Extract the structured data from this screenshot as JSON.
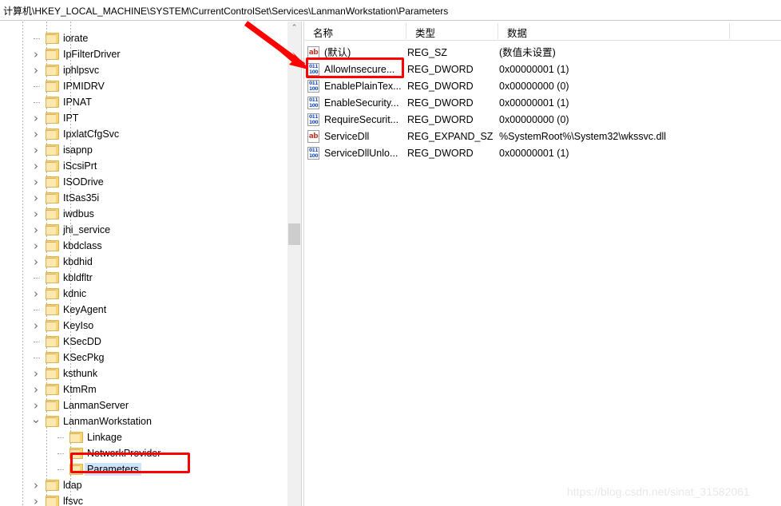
{
  "address": {
    "path": "计算机\\HKEY_LOCAL_MACHINE\\SYSTEM\\CurrentControlSet\\Services\\LanmanWorkstation\\Parameters"
  },
  "tree": {
    "scroll_up_glyph": "⌃",
    "items": [
      {
        "label": "iorate",
        "level": 2,
        "expander": "none",
        "selected": false
      },
      {
        "label": "IpFilterDriver",
        "level": 2,
        "expander": "collapsed",
        "selected": false
      },
      {
        "label": "iphlpsvc",
        "level": 2,
        "expander": "collapsed",
        "selected": false
      },
      {
        "label": "IPMIDRV",
        "level": 2,
        "expander": "none",
        "selected": false
      },
      {
        "label": "IPNAT",
        "level": 2,
        "expander": "none",
        "selected": false
      },
      {
        "label": "IPT",
        "level": 2,
        "expander": "collapsed",
        "selected": false
      },
      {
        "label": "IpxlatCfgSvc",
        "level": 2,
        "expander": "collapsed",
        "selected": false
      },
      {
        "label": "isapnp",
        "level": 2,
        "expander": "collapsed",
        "selected": false
      },
      {
        "label": "iScsiPrt",
        "level": 2,
        "expander": "collapsed",
        "selected": false
      },
      {
        "label": "ISODrive",
        "level": 2,
        "expander": "collapsed",
        "selected": false
      },
      {
        "label": "ItSas35i",
        "level": 2,
        "expander": "collapsed",
        "selected": false
      },
      {
        "label": "iwdbus",
        "level": 2,
        "expander": "collapsed",
        "selected": false
      },
      {
        "label": "jhi_service",
        "level": 2,
        "expander": "collapsed",
        "selected": false
      },
      {
        "label": "kbdclass",
        "level": 2,
        "expander": "collapsed",
        "selected": false
      },
      {
        "label": "kbdhid",
        "level": 2,
        "expander": "collapsed",
        "selected": false
      },
      {
        "label": "kbldfltr",
        "level": 2,
        "expander": "none",
        "selected": false
      },
      {
        "label": "kdnic",
        "level": 2,
        "expander": "collapsed",
        "selected": false
      },
      {
        "label": "KeyAgent",
        "level": 2,
        "expander": "none",
        "selected": false
      },
      {
        "label": "KeyIso",
        "level": 2,
        "expander": "collapsed",
        "selected": false
      },
      {
        "label": "KSecDD",
        "level": 2,
        "expander": "none",
        "selected": false
      },
      {
        "label": "KSecPkg",
        "level": 2,
        "expander": "none",
        "selected": false
      },
      {
        "label": "ksthunk",
        "level": 2,
        "expander": "collapsed",
        "selected": false
      },
      {
        "label": "KtmRm",
        "level": 2,
        "expander": "collapsed",
        "selected": false
      },
      {
        "label": "LanmanServer",
        "level": 2,
        "expander": "collapsed",
        "selected": false
      },
      {
        "label": "LanmanWorkstation",
        "level": 2,
        "expander": "expanded",
        "selected": false
      },
      {
        "label": "Linkage",
        "level": 3,
        "expander": "none",
        "selected": false
      },
      {
        "label": "NetworkProvider",
        "level": 3,
        "expander": "none",
        "selected": false
      },
      {
        "label": "Parameters",
        "level": 3,
        "expander": "none",
        "selected": true
      },
      {
        "label": "ldap",
        "level": 2,
        "expander": "collapsed",
        "selected": false
      },
      {
        "label": "lfsvc",
        "level": 2,
        "expander": "collapsed",
        "selected": false
      }
    ]
  },
  "value_list": {
    "columns": [
      {
        "label": "名称"
      },
      {
        "label": "类型"
      },
      {
        "label": "数据"
      }
    ],
    "rows": [
      {
        "icon": "string",
        "icon_text": "ab",
        "name": "(默认)",
        "type": "REG_SZ",
        "data": "(数值未设置)"
      },
      {
        "icon": "dword",
        "icon_text": "011",
        "name": "AllowInsecure...",
        "type": "REG_DWORD",
        "data": "0x00000001 (1)"
      },
      {
        "icon": "dword",
        "icon_text": "011",
        "name": "EnablePlainTex...",
        "type": "REG_DWORD",
        "data": "0x00000000 (0)"
      },
      {
        "icon": "dword",
        "icon_text": "011",
        "name": "EnableSecurity...",
        "type": "REG_DWORD",
        "data": "0x00000001 (1)"
      },
      {
        "icon": "dword",
        "icon_text": "011",
        "name": "RequireSecurit...",
        "type": "REG_DWORD",
        "data": "0x00000000 (0)"
      },
      {
        "icon": "string",
        "icon_text": "ab",
        "name": "ServiceDll",
        "type": "REG_EXPAND_SZ",
        "data": "%SystemRoot%\\System32\\wkssvc.dll"
      },
      {
        "icon": "dword",
        "icon_text": "011",
        "name": "ServiceDllUnlo...",
        "type": "REG_DWORD",
        "data": "0x00000001 (1)"
      }
    ]
  },
  "annotations": {
    "highlight_color": "#fe0000",
    "arrow_label": "red-pointer-arrow"
  },
  "watermark": {
    "text": "https://blog.csdn.net/sinat_31582061"
  }
}
